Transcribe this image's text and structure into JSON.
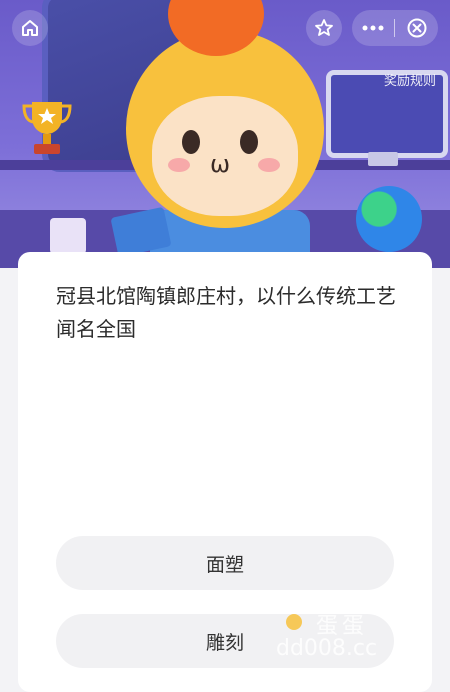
{
  "header": {
    "home_icon": "home-icon",
    "star_icon": "star-icon",
    "more_icon": "more-dots-icon",
    "close_icon": "close-circle-icon",
    "reward_rules_label": "奖励规则"
  },
  "question": {
    "text": "冠县北馆陶镇郎庄村，以什么传统工艺闻名全国"
  },
  "options": [
    {
      "label": "面塑"
    },
    {
      "label": "雕刻"
    }
  ],
  "watermark": {
    "line1": "蛋蛋",
    "line2": "dd008.cc"
  },
  "colors": {
    "scene_purple": "#6a5bc9",
    "card_bg": "#ffffff",
    "option_bg": "#f1f1f3",
    "mascot_yellow": "#f8c13d"
  }
}
